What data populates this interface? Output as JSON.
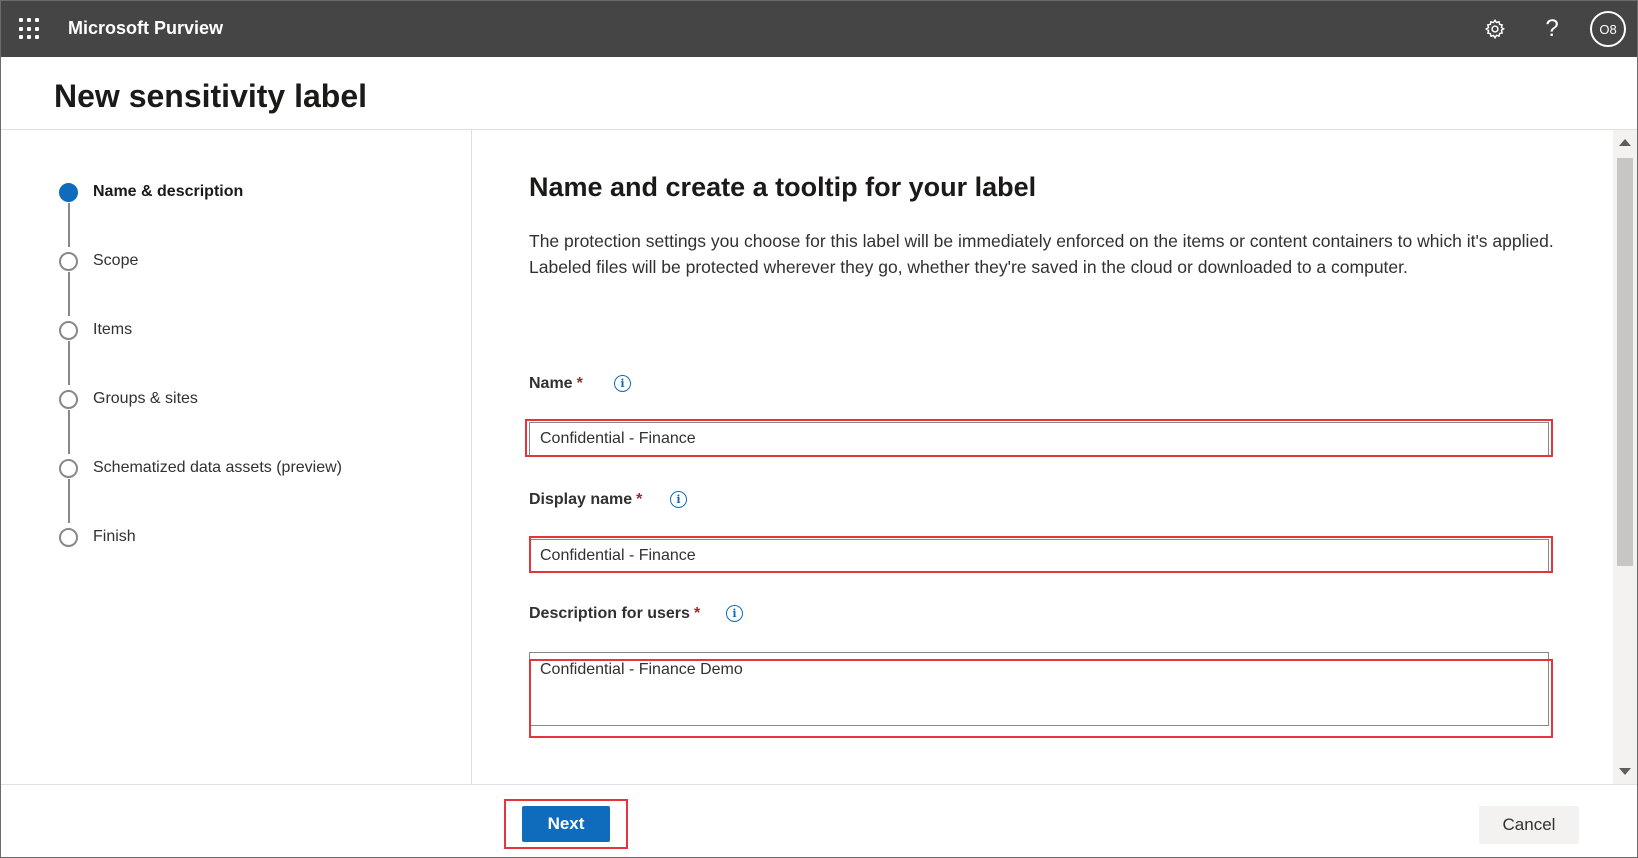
{
  "app": {
    "title": "Microsoft Purview",
    "avatar_initials": "O8"
  },
  "header": {
    "title": "New sensitivity label"
  },
  "stepper": {
    "steps": [
      {
        "label": "Name & description",
        "active": true
      },
      {
        "label": "Scope",
        "active": false
      },
      {
        "label": "Items",
        "active": false
      },
      {
        "label": "Groups & sites",
        "active": false
      },
      {
        "label": "Schematized data assets (preview)",
        "active": false
      },
      {
        "label": "Finish",
        "active": false
      }
    ]
  },
  "main": {
    "title": "Name and create a tooltip for your label",
    "description": "The protection settings you choose for this label will be immediately enforced on the items or content containers to which it's applied. Labeled files will be protected wherever they go, whether they're saved in the cloud or downloaded to a computer.",
    "fields": {
      "name": {
        "label": "Name",
        "required_mark": "*",
        "value": "Confidential - Finance"
      },
      "display_name": {
        "label": "Display name",
        "required_mark": "*",
        "value": "Confidential - Finance"
      },
      "description": {
        "label": "Description for users",
        "required_mark": "*",
        "value": "Confidential - Finance Demo"
      }
    }
  },
  "footer": {
    "next_label": "Next",
    "cancel_label": "Cancel"
  },
  "colors": {
    "topbar": "#454545",
    "accent": "#0f6cbd",
    "highlight": "#e3353b"
  },
  "icons": {
    "waffle": "app-launcher-icon",
    "settings": "gear-icon",
    "help": "help-icon",
    "info": "info-icon"
  }
}
